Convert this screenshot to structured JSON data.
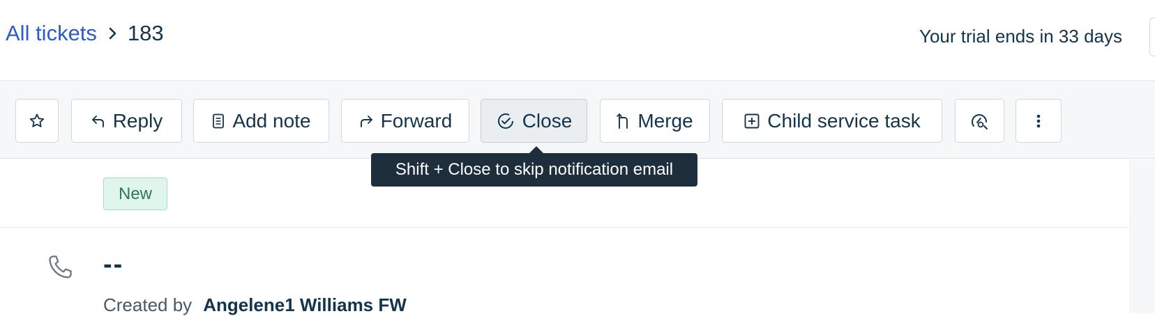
{
  "breadcrumb": {
    "all_tickets": "All tickets",
    "separator_icon": "chevron-right-icon",
    "ticket_id": "183"
  },
  "trial_banner": "Your trial ends in 33 days",
  "toolbar": {
    "star_icon": "star-icon",
    "reply": "Reply",
    "add_note": "Add note",
    "forward": "Forward",
    "close": "Close",
    "merge": "Merge",
    "child_service_task": "Child service task",
    "extra_icon": "agent-assist-icon",
    "more_icon": "more-vertical-icon"
  },
  "tooltip": "Shift + Close to skip notification email",
  "ticket": {
    "status": "New",
    "subject": "--",
    "created_by_label": "Created by",
    "created_by": "Angelene1 Williams FW",
    "source_icon": "phone-icon"
  },
  "colors": {
    "link": "#2c5cc5",
    "text": "#12344d",
    "toolbar_bg": "#f5f7f9",
    "tooltip_bg": "#1f2e3d",
    "status_new_bg": "#e0f5eb",
    "status_new_text": "#2f7a55"
  }
}
